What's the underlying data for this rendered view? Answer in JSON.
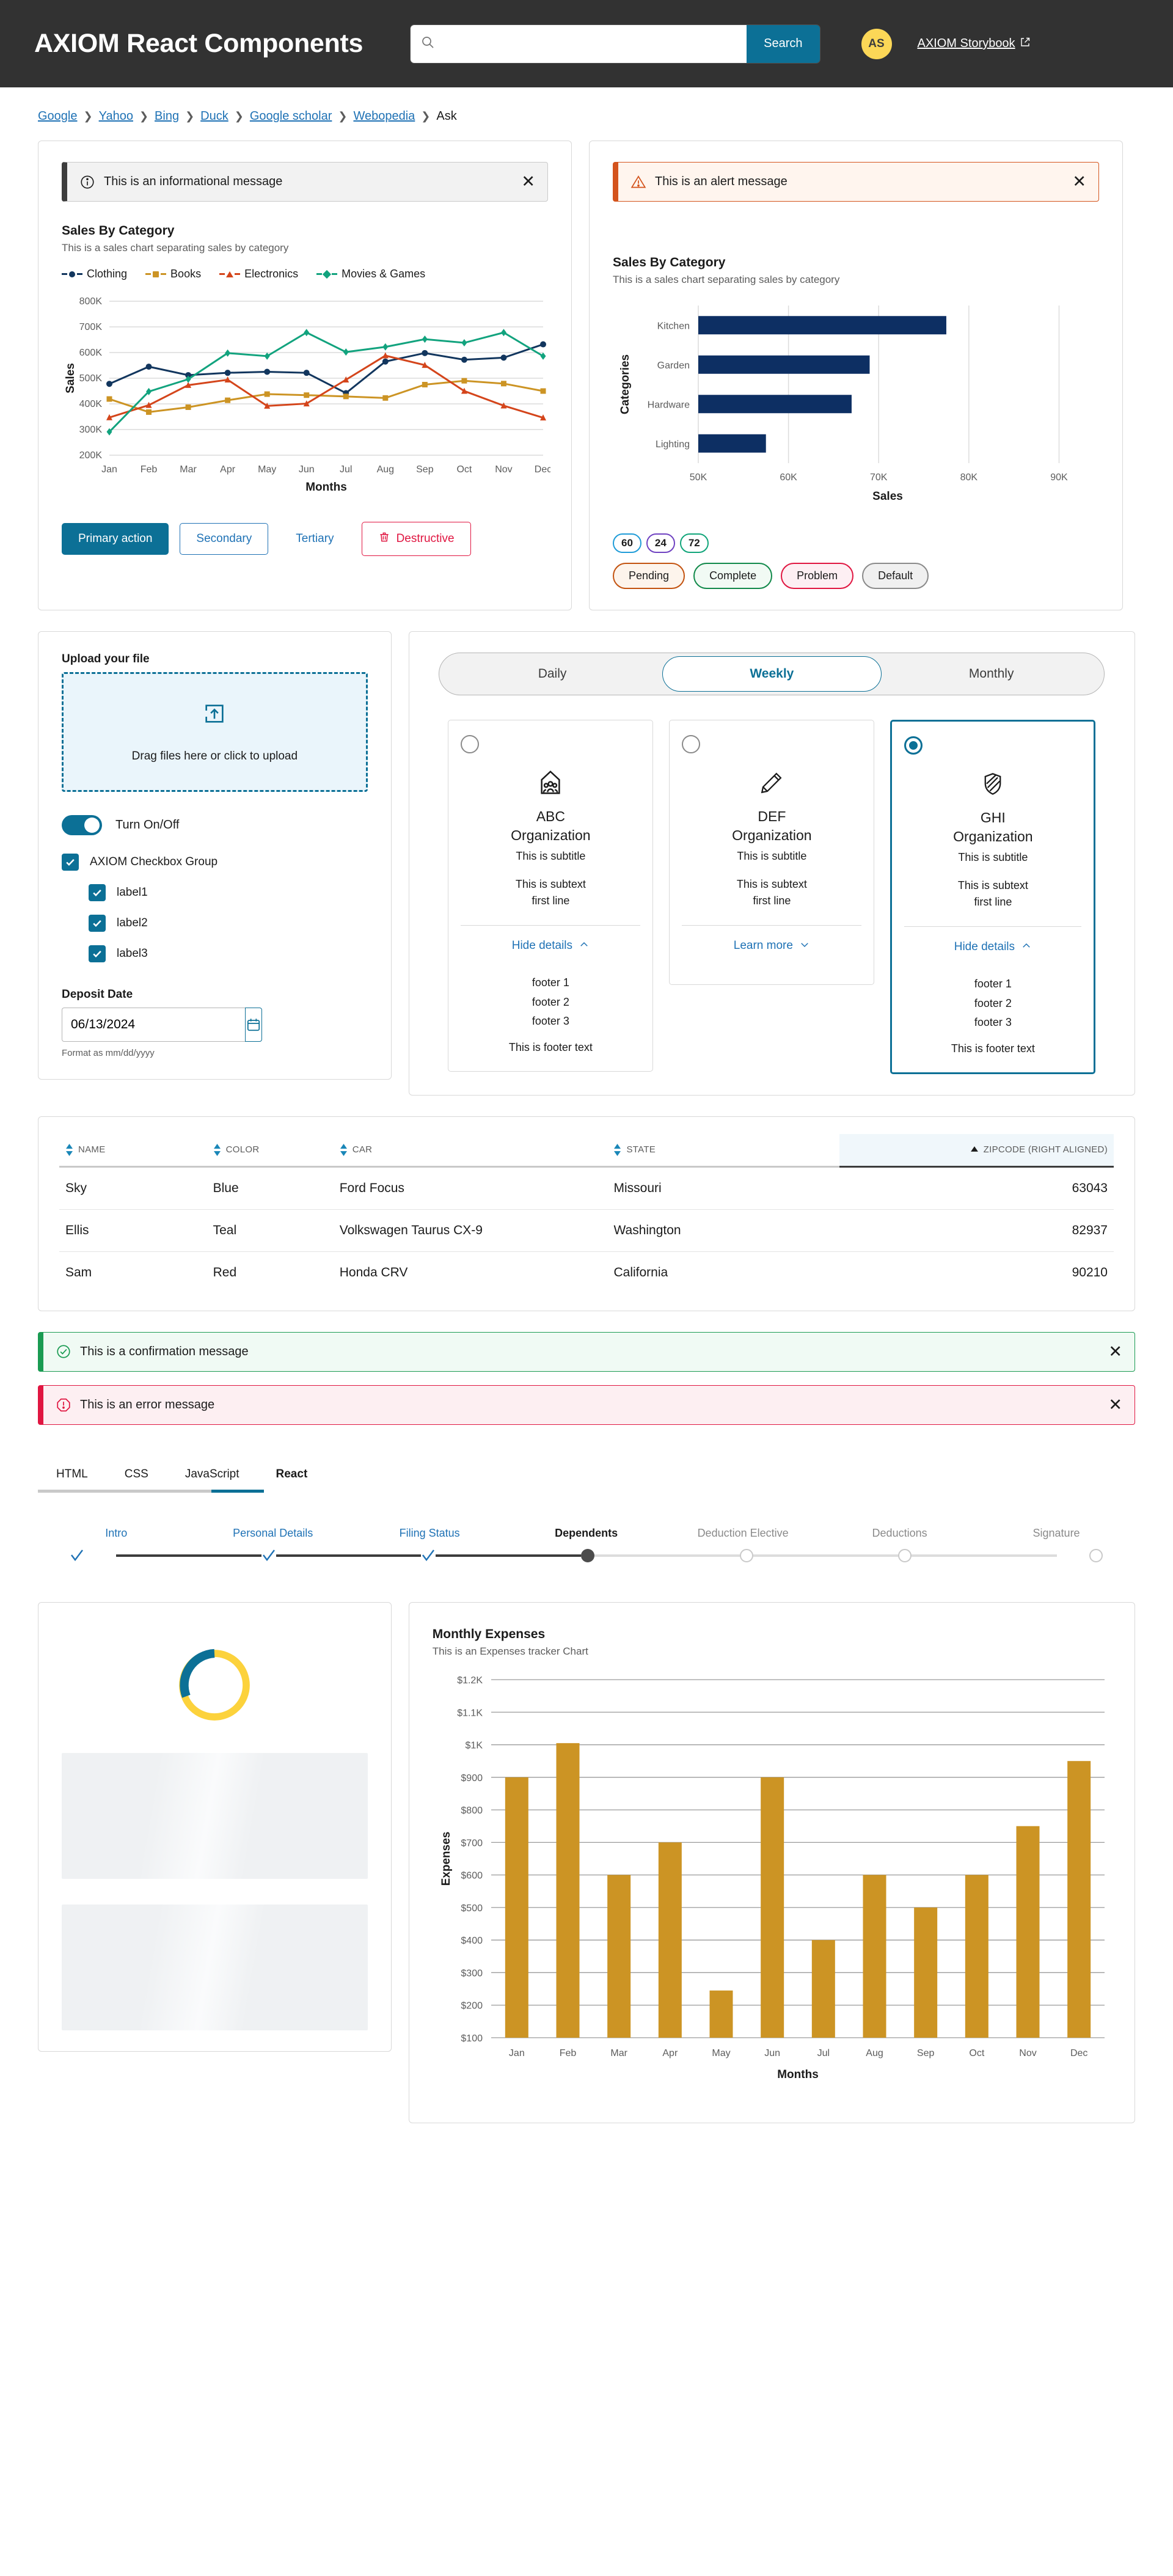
{
  "header": {
    "brand": "AXIOM React Components",
    "search": {
      "value": "",
      "placeholder": "",
      "button_label": "Search"
    },
    "avatar_initials": "AS",
    "storybook_label": "AXIOM Storybook"
  },
  "breadcrumb": {
    "links": [
      "Google",
      "Yahoo",
      "Bing",
      "Duck",
      "Google scholar",
      "Webopedia"
    ],
    "current": "Ask"
  },
  "alerts": {
    "info": "This is an informational message",
    "warning": "This is an alert message",
    "confirmation": "This is a confirmation message",
    "error": "This is an error message"
  },
  "buttons": {
    "primary": "Primary action",
    "secondary": "Secondary",
    "tertiary": "Tertiary",
    "destructive": "Destructive"
  },
  "badges": {
    "counts": [
      {
        "value": "60",
        "color": "#1f9cd8"
      },
      {
        "value": "24",
        "color": "#6f42c1"
      },
      {
        "value": "72",
        "color": "#11a57a"
      }
    ],
    "pills": [
      {
        "label": "Pending",
        "border": "#c35310",
        "bg": "#fdf4ec"
      },
      {
        "label": "Complete",
        "border": "#11894a",
        "bg": "#f1faf4"
      },
      {
        "label": "Problem",
        "border": "#e01641",
        "bg": "#fdeff3"
      },
      {
        "label": "Default",
        "border": "#8a8a8a",
        "bg": "#f0f0f0"
      }
    ]
  },
  "upload": {
    "label": "Upload your file",
    "dropzone_text": "Drag files here or click to upload",
    "toggle_label": "Turn On/Off",
    "checkbox_group_label": "AXIOM Checkbox Group",
    "checkbox_items": [
      "label1",
      "label2",
      "label3"
    ],
    "date_label": "Deposit Date",
    "date_value": "06/13/2024",
    "date_hint": "Format as mm/dd/yyyy"
  },
  "segmented": {
    "options": [
      "Daily",
      "Weekly",
      "Monthly"
    ],
    "selected": "Weekly"
  },
  "sel_cards": [
    {
      "icon": "org-people-icon",
      "title": "ABC",
      "org": "Organization",
      "subtitle": "This is subtitle",
      "subtext": "This is subtext",
      "subtext2": "first line",
      "link": "Hide details",
      "link_chevron": "chevron-up",
      "expanded": true,
      "footers": [
        "footer 1",
        "footer 2",
        "footer 3"
      ],
      "footer_text": "This is footer text",
      "selected": false
    },
    {
      "icon": "pencil-icon",
      "title": "DEF",
      "org": "Organization",
      "subtitle": "This is subtitle",
      "subtext": "This is subtext",
      "subtext2": "first line",
      "link": "Learn more",
      "link_chevron": "chevron-down",
      "expanded": false,
      "footers": [],
      "footer_text": "",
      "selected": false
    },
    {
      "icon": "shield-slash-icon",
      "title": "GHI",
      "org": "Organization",
      "subtitle": "This is subtitle",
      "subtext": "This is subtext",
      "subtext2": "first line",
      "link": "Hide details",
      "link_chevron": "chevron-up",
      "expanded": true,
      "footers": [
        "footer 1",
        "footer 2",
        "footer 3"
      ],
      "footer_text": "This is footer text",
      "selected": true
    }
  ],
  "table": {
    "columns": [
      {
        "label": "NAME",
        "sortable": true,
        "align": "left",
        "sorted": false
      },
      {
        "label": "COLOR",
        "sortable": true,
        "align": "left",
        "sorted": false
      },
      {
        "label": "CAR",
        "sortable": true,
        "align": "left",
        "sorted": false
      },
      {
        "label": "STATE",
        "sortable": true,
        "align": "left",
        "sorted": false
      },
      {
        "label": "ZIPCODE (RIGHT ALIGNED)",
        "sortable": true,
        "align": "right",
        "sorted": true
      }
    ],
    "rows": [
      [
        "Sky",
        "Blue",
        "Ford Focus",
        "Missouri",
        "63043"
      ],
      [
        "Ellis",
        "Teal",
        "Volkswagen Taurus CX-9",
        "Washington",
        "82937"
      ],
      [
        "Sam",
        "Red",
        "Honda CRV",
        "California",
        "90210"
      ]
    ]
  },
  "tabs": {
    "items": [
      "HTML",
      "CSS",
      "JavaScript",
      "React"
    ],
    "active": "React"
  },
  "stepper": {
    "steps": [
      {
        "label": "Intro",
        "state": "done"
      },
      {
        "label": "Personal Details",
        "state": "done"
      },
      {
        "label": "Filing Status",
        "state": "done"
      },
      {
        "label": "Dependents",
        "state": "current"
      },
      {
        "label": "Deduction Elective",
        "state": "todo"
      },
      {
        "label": "Deductions",
        "state": "todo"
      },
      {
        "label": "Signature",
        "state": "todo"
      }
    ]
  },
  "spinner": {
    "arc_color": "#0c7096",
    "track_color": "#fcd23c"
  },
  "chart_data": [
    {
      "id": "sales-line-chart",
      "type": "line",
      "title": "Sales By Category",
      "subtitle": "This is a sales chart separating sales by category",
      "xlabel": "Months",
      "ylabel": "Sales",
      "categories": [
        "Jan",
        "Feb",
        "Mar",
        "Apr",
        "May",
        "Jun",
        "Jul",
        "Aug",
        "Sep",
        "Oct",
        "Nov",
        "Dec"
      ],
      "ylim": [
        200000,
        800000
      ],
      "yticks": [
        "200K",
        "300K",
        "400K",
        "500K",
        "600K",
        "700K",
        "800K"
      ],
      "grid": true,
      "legend_position": "top-left",
      "series": [
        {
          "name": "Clothing",
          "color": "#12365e",
          "marker": "circle",
          "values": [
            478000,
            545000,
            512000,
            521000,
            525000,
            521000,
            442000,
            565000,
            598000,
            572000,
            580000,
            632000
          ]
        },
        {
          "name": "Books",
          "color": "#cc9424",
          "marker": "square",
          "values": [
            419000,
            368000,
            387000,
            414000,
            438000,
            434000,
            429000,
            423000,
            475000,
            490000,
            479000,
            450000
          ]
        },
        {
          "name": "Electronics",
          "color": "#d4451b",
          "marker": "triangle",
          "values": [
            347000,
            395000,
            473000,
            494000,
            392000,
            401000,
            494000,
            588000,
            551000,
            450000,
            393000,
            346000
          ]
        },
        {
          "name": "Movies & Games",
          "color": "#12a37e",
          "marker": "diamond",
          "values": [
            291000,
            448000,
            496000,
            598000,
            586000,
            678000,
            602000,
            622000,
            652000,
            638000,
            678000,
            586000
          ]
        }
      ]
    },
    {
      "id": "sales-bar-chart",
      "type": "bar",
      "orientation": "horizontal",
      "title": "Sales By Category",
      "subtitle": "This is a sales chart separating sales by category",
      "xlabel": "Sales",
      "ylabel": "Categories",
      "categories": [
        "Kitchen",
        "Garden",
        "Hardware",
        "Lighting"
      ],
      "values": [
        77500,
        69000,
        67000,
        57500
      ],
      "xlim": [
        50000,
        92000
      ],
      "xticks": [
        "50K",
        "60K",
        "70K",
        "80K",
        "90K"
      ],
      "color": "#0d2f63",
      "grid": true
    },
    {
      "id": "monthly-expenses-chart",
      "type": "bar",
      "orientation": "vertical",
      "title": "Monthly Expenses",
      "subtitle": "This is an Expenses tracker Chart",
      "xlabel": "Months",
      "ylabel": "Expenses",
      "categories": [
        "Jan",
        "Feb",
        "Mar",
        "Apr",
        "May",
        "Jun",
        "Jul",
        "Aug",
        "Sep",
        "Oct",
        "Nov",
        "Dec"
      ],
      "values": [
        900,
        1005,
        600,
        700,
        245,
        900,
        400,
        600,
        500,
        600,
        750,
        950
      ],
      "ylim": [
        100,
        1200
      ],
      "yticks": [
        "$100",
        "$200",
        "$300",
        "$400",
        "$500",
        "$600",
        "$700",
        "$800",
        "$900",
        "$1K",
        "$1.1K",
        "$1.2K"
      ],
      "color": "#cc9424",
      "grid": true
    }
  ]
}
